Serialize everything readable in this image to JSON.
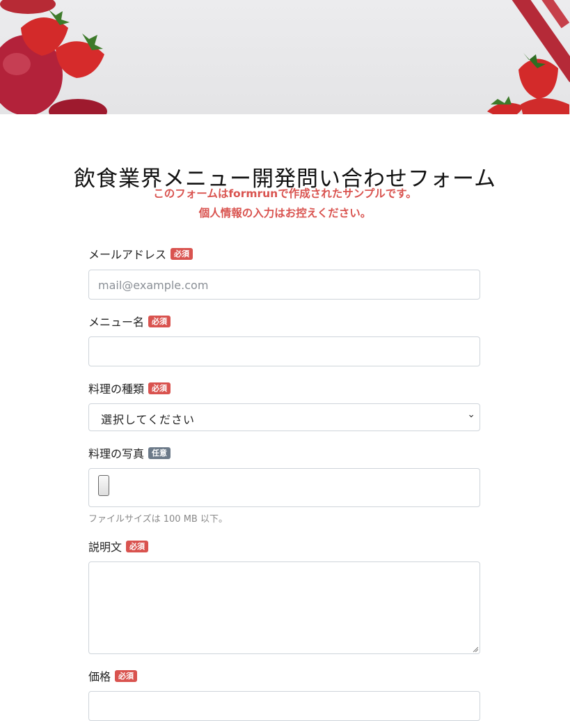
{
  "header": {
    "title": "飲食業界メニュー開発問い合わせフォーム",
    "notice_line1": "このフォームはformrunで作成されたサンプルです。",
    "notice_line2": "個人情報の入力はお控えください。"
  },
  "colors": {
    "required": "#d9534f",
    "optional": "#6c7a89",
    "notice": "#d9534f"
  },
  "fields": {
    "email": {
      "label": "メールアドレス",
      "badge": "必須",
      "placeholder": "mail@example.com"
    },
    "menu_name": {
      "label": "メニュー名",
      "badge": "必須",
      "value": ""
    },
    "cuisine_type": {
      "label": "料理の種類",
      "badge": "必須",
      "selected": "選択してください"
    },
    "photo": {
      "label": "料理の写真",
      "badge": "任意",
      "help": "ファイルサイズは 100 MB 以下。"
    },
    "description": {
      "label": "説明文",
      "badge": "必須",
      "value": ""
    },
    "price": {
      "label": "価格",
      "badge": "必須",
      "value": ""
    }
  }
}
